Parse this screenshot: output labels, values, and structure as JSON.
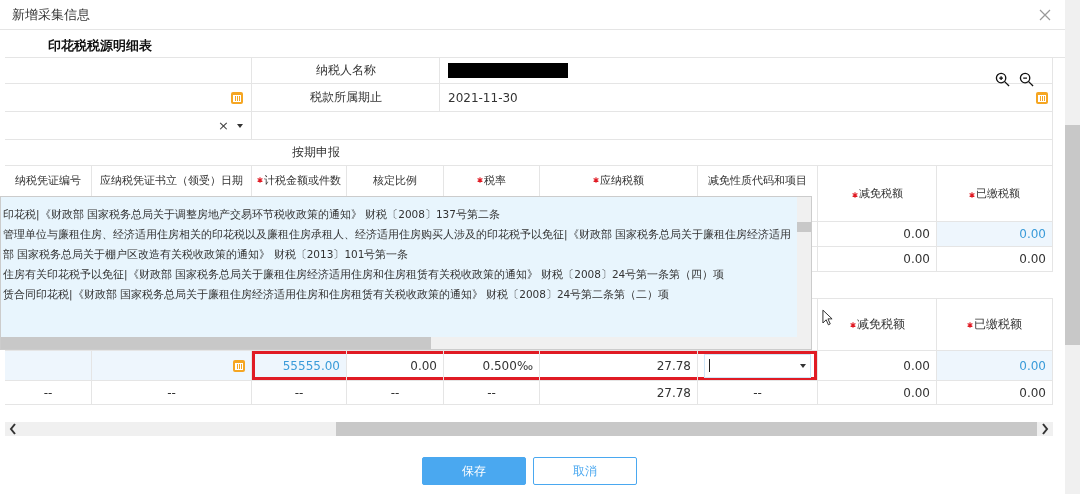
{
  "dialog": {
    "title": "新增采集信息"
  },
  "section_title": "印花税税源明细表",
  "form": {
    "rows": [
      {
        "kind": "name",
        "label": "纳税人名称",
        "redacted": true
      },
      {
        "kind": "date",
        "label": "税款所属期止",
        "value": "2021-11-30"
      },
      {
        "kind": "select",
        "clear": "×"
      },
      {
        "kind": "declare",
        "value": "按期申报"
      }
    ]
  },
  "table": {
    "columns": [
      {
        "label": "纳税凭证编号",
        "required": false
      },
      {
        "label": "应纳税凭证书立（领受）日期",
        "required": false
      },
      {
        "label": "计税金额或件数",
        "required": true
      },
      {
        "label": "核定比例",
        "required": false
      },
      {
        "label": "税率",
        "required": true
      },
      {
        "label": "应纳税额",
        "required": true
      },
      {
        "label": "减免性质代码和项目",
        "required": false
      },
      {
        "label": "减免税额",
        "required": true
      },
      {
        "label": "已缴税额",
        "required": true
      }
    ],
    "rows": [
      {
        "kind": "data",
        "cells": [
          {
            "kind": "blank"
          },
          {
            "kind": "blank"
          },
          {
            "kind": "blank"
          },
          {
            "kind": "blank"
          },
          {
            "kind": "blank"
          },
          {
            "kind": "blank"
          },
          {
            "kind": "blank"
          },
          {
            "kind": "text",
            "value": "0.00"
          },
          {
            "kind": "text",
            "value": "0.00",
            "link": true,
            "editable": true
          }
        ]
      },
      {
        "kind": "data",
        "cells": [
          {
            "kind": "blank"
          },
          {
            "kind": "blank"
          },
          {
            "kind": "blank"
          },
          {
            "kind": "blank"
          },
          {
            "kind": "blank"
          },
          {
            "kind": "blank"
          },
          {
            "kind": "blank"
          },
          {
            "kind": "text",
            "value": "0.00"
          },
          {
            "kind": "text",
            "value": "0.00"
          }
        ]
      },
      {
        "kind": "gap"
      },
      {
        "kind": "header",
        "labels": [
          {
            "label": "减免税额",
            "required": true
          },
          {
            "label": "已缴税额",
            "required": true
          }
        ]
      },
      {
        "kind": "data",
        "cells": [
          {
            "kind": "blank",
            "editable": true
          },
          {
            "kind": "date",
            "editable": true
          },
          {
            "kind": "text",
            "value": "55555.00",
            "link": true,
            "editable": true,
            "highlighted": true
          },
          {
            "kind": "text",
            "value": "0.00",
            "highlighted": true
          },
          {
            "kind": "text",
            "value": "0.500‰",
            "highlighted": true
          },
          {
            "kind": "text",
            "value": "27.78",
            "highlighted": true
          },
          {
            "kind": "select",
            "focused": true,
            "highlighted": true
          },
          {
            "kind": "text",
            "value": "0.00"
          },
          {
            "kind": "text",
            "value": "0.00",
            "link": true,
            "editable": true
          }
        ]
      },
      {
        "kind": "total",
        "cells": [
          {
            "kind": "dash",
            "value": "--"
          },
          {
            "kind": "dash",
            "value": "--"
          },
          {
            "kind": "dash",
            "value": "--"
          },
          {
            "kind": "dash",
            "value": "--"
          },
          {
            "kind": "dash",
            "value": "--"
          },
          {
            "kind": "text",
            "value": "27.78"
          },
          {
            "kind": "dash",
            "value": "--"
          },
          {
            "kind": "text",
            "value": "0.00"
          },
          {
            "kind": "text",
            "value": "0.00"
          }
        ]
      }
    ]
  },
  "dropdown": {
    "options": [
      "印花税|《财政部 国家税务总局关于调整房地产交易环节税收政策的通知》 财税〔2008〕137号第二条",
      "管理单位与廉租住房、经济适用住房相关的印花税以及廉租住房承租人、经济适用住房购买人涉及的印花税予以免征|《财政部 国家税务总局关于廉租住房经济适用",
      "部 国家税务总局关于棚户区改造有关税收政策的通知》 财税〔2013〕101号第一条",
      "住房有关印花税予以免征|《财政部 国家税务总局关于廉租住房经济适用住房和住房租赁有关税收政策的通知》 财税〔2008〕24号第一条第（四）项",
      "赁合同印花税|《财政部 国家税务总局关于廉租住房经济适用住房和住房租赁有关税收政策的通知》 财税〔2008〕24号第二条第（二）项"
    ]
  },
  "buttons": [
    {
      "label": "保存",
      "kind": "primary"
    },
    {
      "label": "取消",
      "kind": "secondary"
    }
  ]
}
